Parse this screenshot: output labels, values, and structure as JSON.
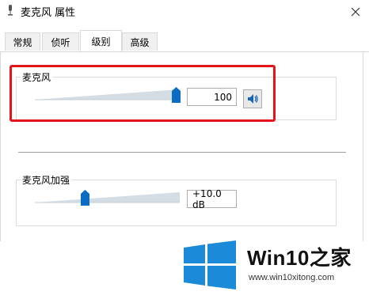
{
  "window": {
    "title": "麦克风 属性",
    "icon": "microphone-icon",
    "close_icon": "close-icon"
  },
  "tabs": [
    {
      "label": "常规",
      "active": false
    },
    {
      "label": "侦听",
      "active": false
    },
    {
      "label": "级别",
      "active": true
    },
    {
      "label": "高级",
      "active": false
    }
  ],
  "microphone": {
    "label": "麦克风",
    "value": "100",
    "level": 1.0,
    "mute_icon": "speaker-icon"
  },
  "boost": {
    "label": "麦克风加强",
    "value": "+10.0 dB",
    "level": 0.33
  },
  "watermark": {
    "brand": "Win10之家",
    "url": "www.win10xitong.com",
    "logo_color": "#1b8ad8"
  },
  "colors": {
    "highlight": "#e3141a",
    "thumb": "#0a6cc2"
  }
}
